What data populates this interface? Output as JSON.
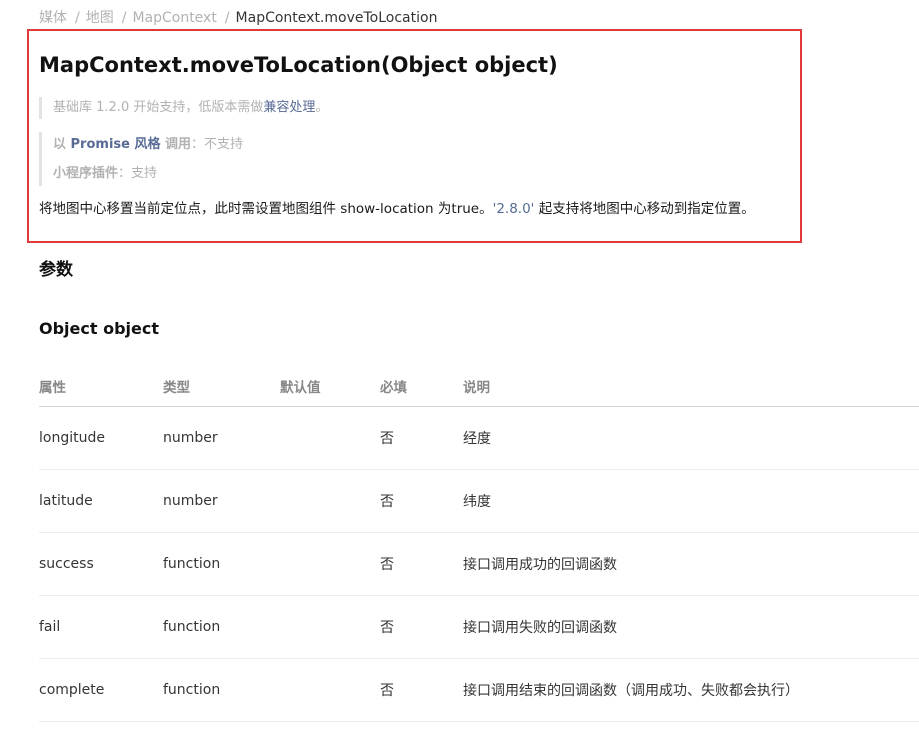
{
  "breadcrumb": {
    "items": [
      "媒体",
      "地图",
      "MapContext",
      "MapContext.moveToLocation"
    ],
    "separator": "/"
  },
  "api": {
    "title": "MapContext.moveToLocation(Object object)",
    "base_lib_prefix": "基础库 1.2.0 开始支持，低版本需做",
    "base_lib_link": "兼容处理",
    "base_lib_suffix": "。",
    "promise_prefix": "以 ",
    "promise_link": "Promise 风格",
    "promise_middle": " 调用",
    "promise_value": "：不支持",
    "plugin_label": "小程序插件",
    "plugin_value": "：支持",
    "description_main": "将地图中心移置当前定位点，此时需设置地图组件 show-location 为true。",
    "description_code": "'2.8.0'",
    "description_tail": " 起支持将地图中心移动到指定位置。"
  },
  "sections": {
    "params_title": "参数",
    "object_title": "Object object"
  },
  "table": {
    "headers": [
      "属性",
      "类型",
      "默认值",
      "必填",
      "说明"
    ],
    "rows": [
      {
        "attr": "longitude",
        "type": "number",
        "default": "",
        "required": "否",
        "desc": "经度"
      },
      {
        "attr": "latitude",
        "type": "number",
        "default": "",
        "required": "否",
        "desc": "纬度"
      },
      {
        "attr": "success",
        "type": "function",
        "default": "",
        "required": "否",
        "desc": "接口调用成功的回调函数"
      },
      {
        "attr": "fail",
        "type": "function",
        "default": "",
        "required": "否",
        "desc": "接口调用失败的回调函数"
      },
      {
        "attr": "complete",
        "type": "function",
        "default": "",
        "required": "否",
        "desc": "接口调用结束的回调函数（调用成功、失败都会执行）"
      }
    ]
  },
  "colors": {
    "highlight_border": "#e23a3a",
    "link": "#576b95",
    "muted": "#b2b2b2"
  }
}
